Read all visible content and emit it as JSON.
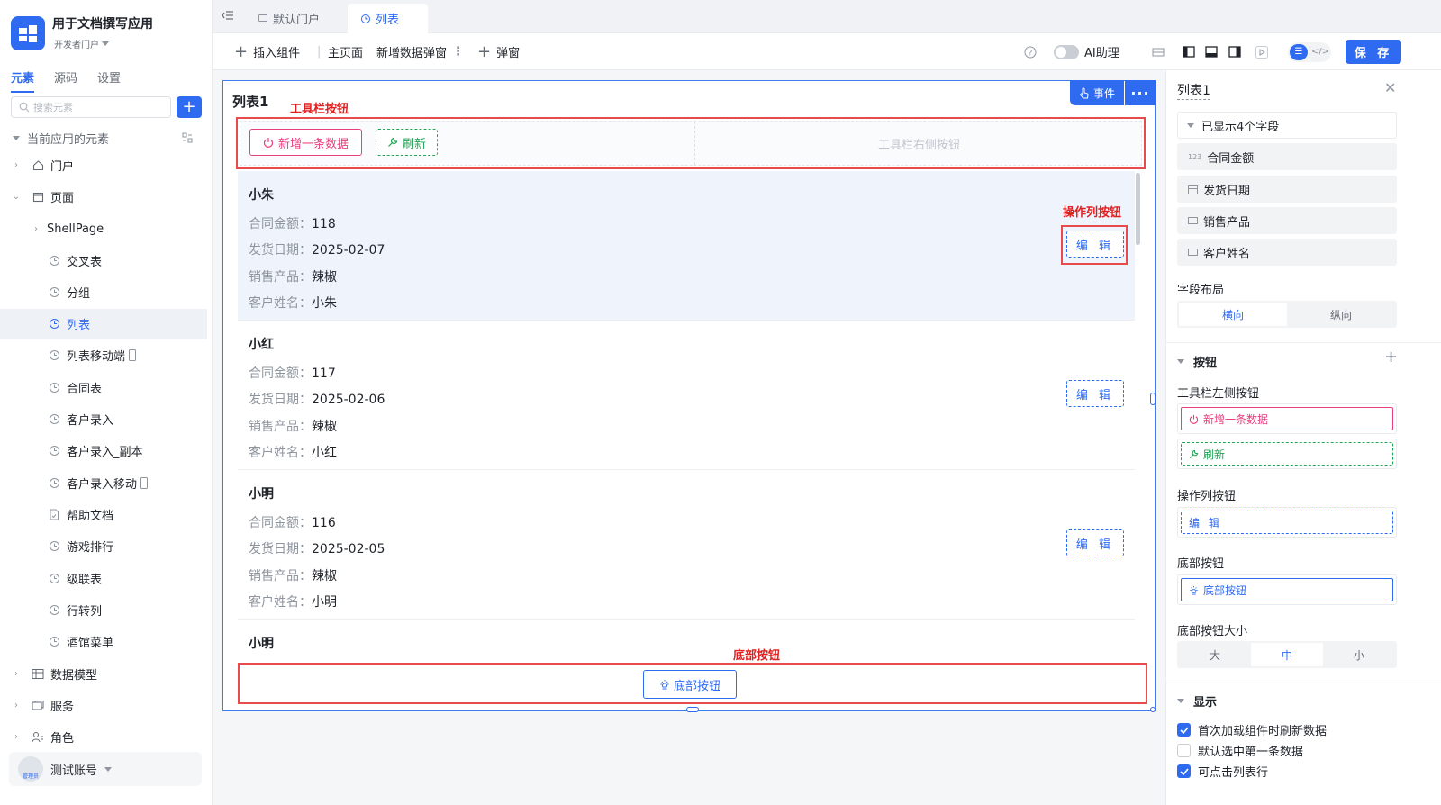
{
  "app": {
    "name": "用于文档撰写应用",
    "portal": "开发者门户"
  },
  "sidebar": {
    "tabs": [
      "元素",
      "源码",
      "设置"
    ],
    "search_placeholder": "搜索元素",
    "section_title": "当前应用的元素",
    "tree": {
      "portal": "门户",
      "pages": "页面",
      "shell": "ShellPage",
      "items": [
        "交叉表",
        "分组",
        "列表",
        "列表移动端",
        "合同表",
        "客户录入",
        "客户录入_副本",
        "客户录入移动",
        "帮助文档",
        "游戏排行",
        "级联表",
        "行转列",
        "酒馆菜单"
      ],
      "data_model": "数据模型",
      "service": "服务",
      "role": "角色"
    },
    "user": {
      "name": "测试账号",
      "avatar_label": "管理员"
    }
  },
  "tabs": [
    {
      "label": "默认门户"
    },
    {
      "label": "列表"
    }
  ],
  "toolbar": {
    "insert": "插入组件",
    "main_page": "主页面",
    "new_popup": "新增数据弹窗",
    "popup": "弹窗",
    "ai": "AI助理",
    "save": "保 存"
  },
  "canvas": {
    "list_title": "列表1",
    "event_label": "事件",
    "annotations": {
      "toolbar_buttons": "工具栏按钮",
      "action_buttons": "操作列按钮",
      "footer_button": "底部按钮"
    },
    "toolbar_left_buttons": [
      "新增一条数据",
      "刷新"
    ],
    "toolbar_right_placeholder": "工具栏右侧按钮",
    "field_labels": [
      "合同金额：",
      "发货日期：",
      "销售产品：",
      "客户姓名："
    ],
    "edit_label": "编 辑",
    "records": [
      {
        "name": "小朱",
        "amount": "118",
        "date": "2025-02-07",
        "product": "辣椒",
        "customer": "小朱"
      },
      {
        "name": "小红",
        "amount": "117",
        "date": "2025-02-06",
        "product": "辣椒",
        "customer": "小红"
      },
      {
        "name": "小明",
        "amount": "116",
        "date": "2025-02-05",
        "product": "辣椒",
        "customer": "小明"
      },
      {
        "name": "小明"
      }
    ],
    "footer_button": "底部按钮"
  },
  "panel": {
    "title": "列表1",
    "fields_header": "已显示4个字段",
    "fields": [
      "合同金额",
      "发货日期",
      "销售产品",
      "客户姓名"
    ],
    "layout_label": "字段布局",
    "layout_options": [
      "横向",
      "纵向"
    ],
    "buttons_section": "按钮",
    "toolbar_left_label": "工具栏左侧按钮",
    "toolbar_left_buttons": [
      "新增一条数据",
      "刷新"
    ],
    "action_label": "操作列按钮",
    "action_button": "编 辑",
    "footer_label": "底部按钮",
    "footer_button": "底部按钮",
    "footer_size_label": "底部按钮大小",
    "size_options": [
      "大",
      "中",
      "小"
    ],
    "display_section": "显示",
    "checks": [
      {
        "label": "首次加载组件时刷新数据",
        "checked": true
      },
      {
        "label": "默认选中第一条数据",
        "checked": false
      },
      {
        "label": "可点击列表行",
        "checked": true
      }
    ]
  },
  "colors": {
    "primary": "#2f6bf0",
    "pink": "#e8407f",
    "green": "#21a453",
    "annotation": "#e02020"
  }
}
